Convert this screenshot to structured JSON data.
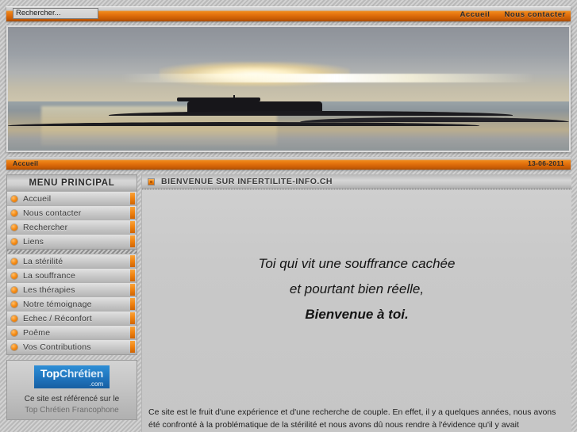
{
  "site": {
    "name": "infertilite-info.ch"
  },
  "topbar": {
    "search": {
      "value": "Rechercher...",
      "placeholder": "Rechercher..."
    },
    "nav": [
      {
        "label": "Accueil"
      },
      {
        "label": "Nous contacter"
      }
    ]
  },
  "banner": {
    "alt": "Coucher de soleil sur la mer avec fort sur un ilot"
  },
  "breadcrumb": {
    "path": "Accueil",
    "date": "13-06-2011"
  },
  "sidebar": {
    "title": "MENU PRINCIPAL",
    "group1": [
      {
        "label": "Accueil"
      },
      {
        "label": "Nous contacter"
      },
      {
        "label": "Rechercher"
      },
      {
        "label": "Liens"
      }
    ],
    "group2": [
      {
        "label": "La stérilité"
      },
      {
        "label": "La souffrance"
      },
      {
        "label": "Les thérapies"
      },
      {
        "label": "Notre témoignage"
      },
      {
        "label": "Echec / Réconfort"
      },
      {
        "label": "Poême"
      },
      {
        "label": "Vos Contributions"
      }
    ],
    "sponsor": {
      "logo_top": "Top",
      "logo_chretien": "Chrétien",
      "logo_domain": ".com",
      "line1": "Ce site est référencé sur le",
      "line2": "Top Chrétien Francophone"
    }
  },
  "content": {
    "heading": "BIENVENUE SUR INFERTILITE-INFO.CH",
    "poem": [
      "Toi qui vit une souffrance cachée",
      "et pourtant bien réelle,",
      "Bienvenue à toi."
    ],
    "intro": "Ce site est le fruit d'une expérience et d'une recherche de couple. En effet, il y a quelques années, nous avons été confronté à la problématique de la stérilité et nous avons dû nous rendre à l'évidence qu'il y avait"
  },
  "colors": {
    "accent_orange": "#ef8a1c",
    "accent_orange_dark": "#c85c05",
    "panel_gray": "#c9c9c9",
    "link_blue": "#1f74bd"
  }
}
